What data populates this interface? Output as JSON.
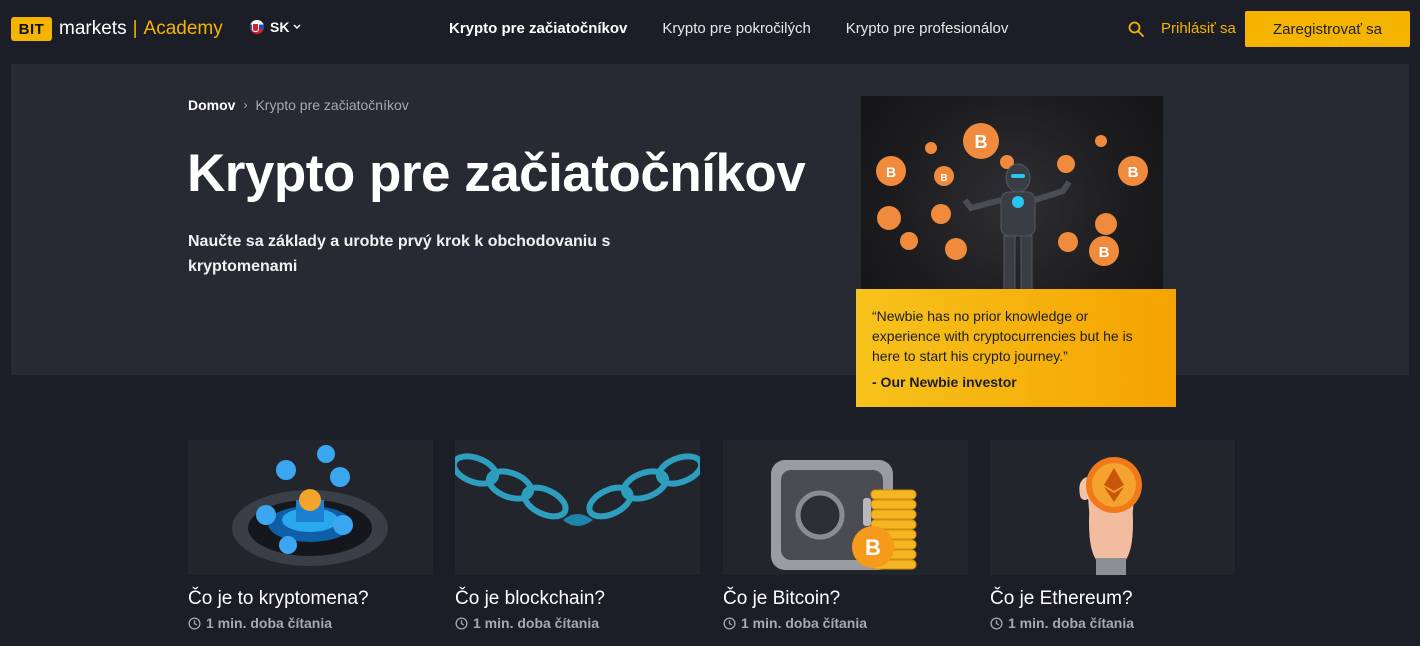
{
  "header": {
    "logo": {
      "badge": "BIT",
      "markets": "markets",
      "separator": "|",
      "academy": "Academy"
    },
    "language": {
      "code": "SK",
      "flag_icon": "slovakia-flag-icon"
    },
    "nav": [
      {
        "label": "Krypto pre začiatočníkov",
        "active": true
      },
      {
        "label": "Krypto pre pokročilých",
        "active": false
      },
      {
        "label": "Krypto pre profesionálov",
        "active": false
      }
    ],
    "login_label": "Prihlásiť sa",
    "register_label": "Zaregistrovať sa",
    "accent_color": "#f5b400"
  },
  "breadcrumb": {
    "home": "Domov",
    "separator": "›",
    "current": "Krypto pre začiatočníkov"
  },
  "hero": {
    "title": "Krypto pre začiatočníkov",
    "subtitle": "Naučte sa základy a urobte prvý krok k obchodovaniu s kryptomenami",
    "quote": "“Newbie has no prior knowledge or experience with cryptocurrencies but he is here to start his crypto journey.”",
    "quote_author": "- Our Newbie investor"
  },
  "cards": [
    {
      "title": "Čo je to kryptomena?",
      "read_time": "1 min. doba čítania",
      "image": "crypto-coins-platform-image"
    },
    {
      "title": "Čo je blockchain?",
      "read_time": "1 min. doba čítania",
      "image": "blockchain-handshake-image"
    },
    {
      "title": "Čo je Bitcoin?",
      "read_time": "1 min. doba čítania",
      "image": "bitcoin-safe-image"
    },
    {
      "title": "Čo je Ethereum?",
      "read_time": "1 min. doba čítania",
      "image": "ethereum-hand-image"
    }
  ]
}
